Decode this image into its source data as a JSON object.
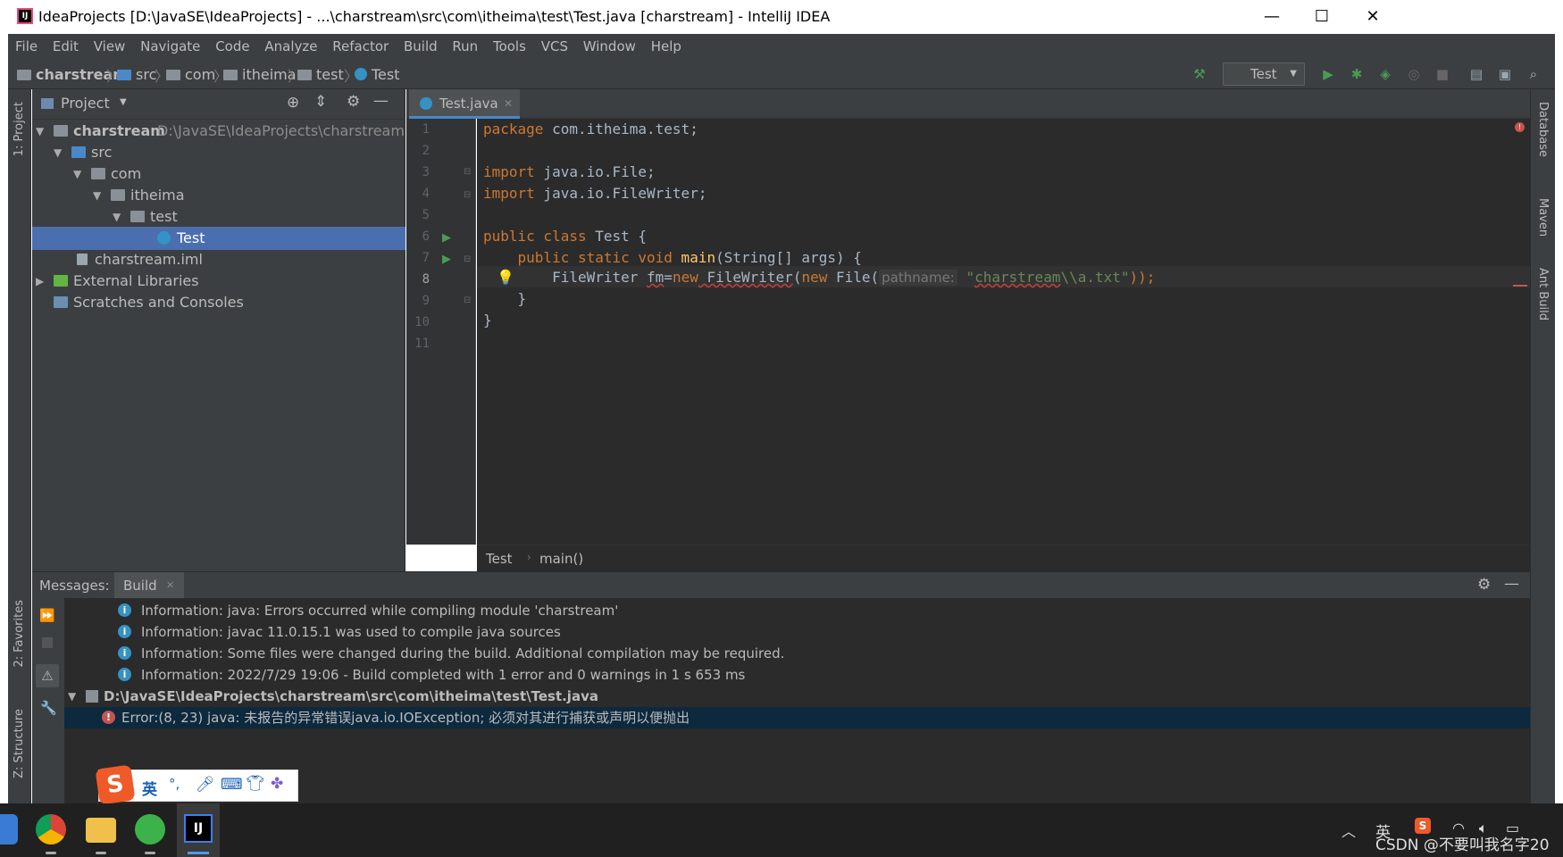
{
  "window": {
    "title": "IdeaProjects [D:\\JavaSE\\IdeaProjects] - ...\\charstream\\src\\com\\itheima\\test\\Test.java [charstream] - IntelliJ IDEA",
    "minimize": "—",
    "maximize": "☐",
    "close": "✕"
  },
  "menu": [
    "File",
    "Edit",
    "View",
    "Navigate",
    "Code",
    "Analyze",
    "Refactor",
    "Build",
    "Run",
    "Tools",
    "VCS",
    "Window",
    "Help"
  ],
  "breadcrumb": [
    "charstream",
    "src",
    "com",
    "itheima",
    "test",
    "Test"
  ],
  "run_config": "Test",
  "left_strip": {
    "project": "1: Project",
    "favorites": "2: Favorites",
    "structure": "Z: Structure"
  },
  "right_strip": {
    "database": "Database",
    "maven": "Maven",
    "ant": "Ant Build"
  },
  "project_panel": {
    "title": "Project",
    "tree": [
      {
        "label": "charstream",
        "path": "D:\\JavaSE\\IdeaProjects\\charstream"
      },
      {
        "label": "src"
      },
      {
        "label": "com"
      },
      {
        "label": "itheima"
      },
      {
        "label": "test"
      },
      {
        "label": "Test"
      },
      {
        "label": "charstream.iml"
      },
      {
        "label": "External Libraries"
      },
      {
        "label": "Scratches and Consoles"
      }
    ]
  },
  "editor": {
    "tab": "Test.java",
    "line_numbers": [
      "1",
      "2",
      "3",
      "4",
      "5",
      "6",
      "7",
      "8",
      "9",
      "10",
      "11"
    ],
    "code": {
      "l1_kw": "package",
      "l1_rest": " com.itheima.test;",
      "l3_kw": "import",
      "l3_rest": " java.io.File;",
      "l4_kw": "import",
      "l4_rest": " java.io.FileWriter;",
      "l6_kw": "public class",
      "l6_rest": " Test {",
      "l7_kw": "    public static void",
      "l7_fn": " main",
      "l7_rest": "(String[] args) {",
      "l8_a": "        FileWriter ",
      "l8_var": "fm",
      "l8_b": "=",
      "l8_kw1": "new",
      "l8_cls": " FileWriter",
      "l8_c": "(",
      "l8_kw2": "new",
      "l8_d": " File(",
      "l8_hint": "pathname:",
      "l8_q1": " \"",
      "l8_str": "charstream",
      "l8_str2": "\\\\a.txt\"",
      "l8_e": "));",
      "l9": "    }",
      "l10": "}"
    },
    "breadcrumb": [
      "Test",
      "main()"
    ]
  },
  "messages": {
    "label": "Messages:",
    "tab": "Build",
    "rows": [
      "Information: java: Errors occurred while compiling module 'charstream'",
      "Information: javac 11.0.15.1 was used to compile java sources",
      "Information: Some files were changed during the build. Additional compilation may be required.",
      "Information: 2022/7/29 19:06 - Build completed with 1 error and 0 warnings in 1 s 653 ms"
    ],
    "file": "D:\\JavaSE\\IdeaProjects\\charstream\\src\\com\\itheima\\test\\Test.java",
    "error": "Error:(8, 23)  java: 未报告的异常错误java.io.IOException; 必须对其进行捕获或声明以便抛出"
  },
  "ime": {
    "logo": "S",
    "lang": "英",
    "punct": "°,"
  },
  "taskbar": {
    "tray_lang": "英",
    "watermark": "CSDN @不要叫我名字20"
  },
  "colors": {
    "accent": "#4a88c7",
    "selection": "#4b6eaf",
    "error": "#c75450"
  }
}
